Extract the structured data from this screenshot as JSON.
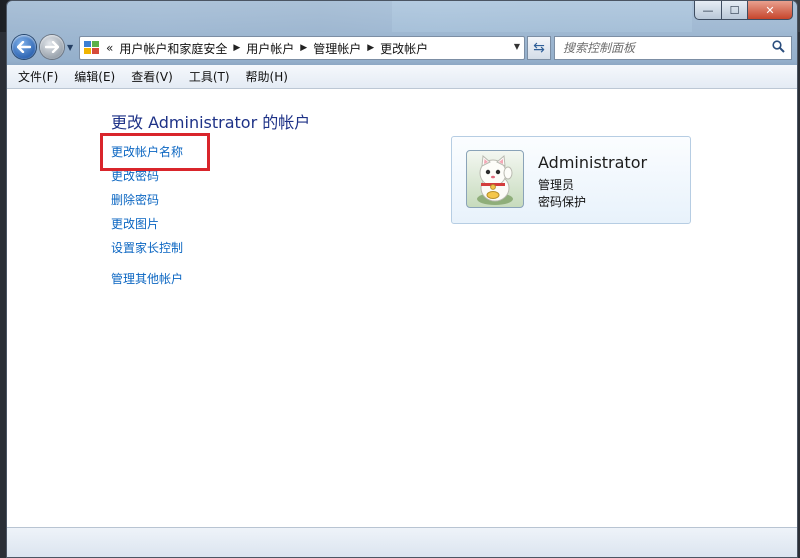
{
  "window": {
    "caption": {
      "minimize_glyph": "—",
      "maximize_glyph": "☐",
      "close_glyph": "✕"
    }
  },
  "nav": {
    "back_icon": "back-arrow-icon",
    "forward_icon": "forward-arrow-icon",
    "breadcrumb": {
      "overflow": "«",
      "items": [
        "用户帐户和家庭安全",
        "用户帐户",
        "管理帐户",
        "更改帐户"
      ]
    },
    "search_placeholder": "搜索控制面板"
  },
  "menu": [
    "文件(F)",
    "编辑(E)",
    "查看(V)",
    "工具(T)",
    "帮助(H)"
  ],
  "page": {
    "title": "更改 Administrator 的帐户",
    "links": {
      "rename": "更改帐户名称",
      "change_password": "更改密码",
      "remove_password": "删除密码",
      "change_picture": "更改图片",
      "parental_controls": "设置家长控制",
      "manage_other": "管理其他帐户"
    }
  },
  "account": {
    "name": "Administrator",
    "role": "管理员",
    "status": "密码保护"
  },
  "colors": {
    "link": "#0b66c2",
    "heading": "#1e3287",
    "highlight": "#d9252b"
  }
}
